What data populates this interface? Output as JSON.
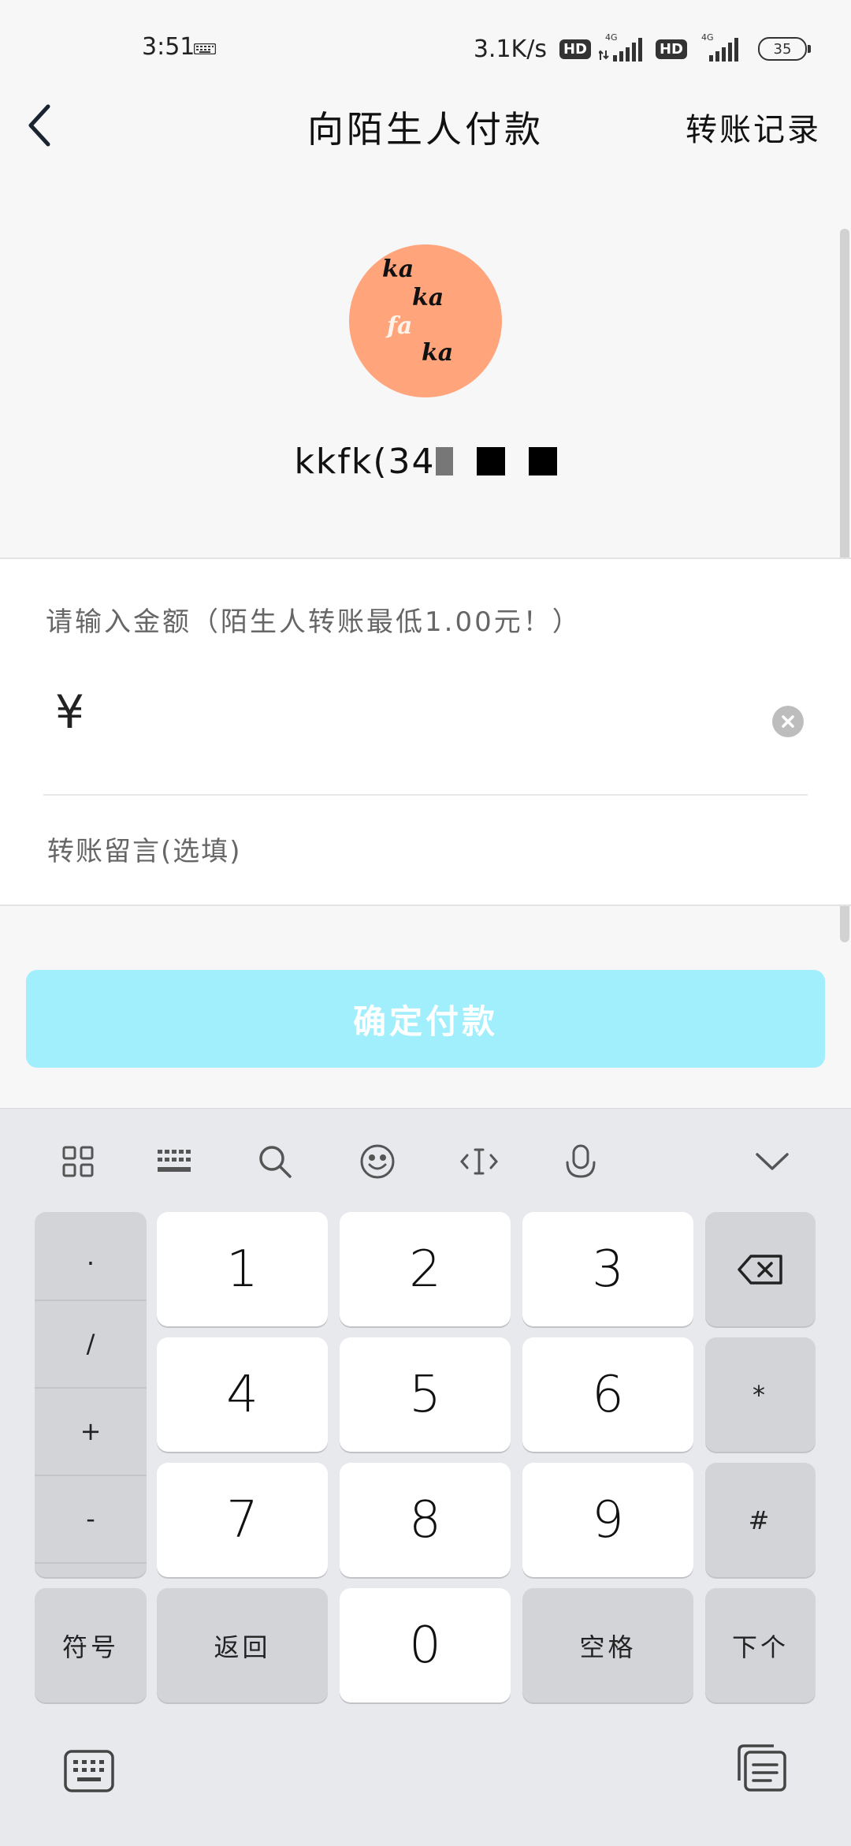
{
  "status_bar": {
    "time": "3:51",
    "net_speed": "3.1K/s",
    "hd_badge": "HD",
    "network_type": "4G",
    "battery": "35"
  },
  "nav": {
    "title": "向陌生人付款",
    "action": "转账记录"
  },
  "profile": {
    "avatar_text": [
      "ka",
      "ka",
      "fa",
      "ka"
    ],
    "name": "kkfk(34"
  },
  "form": {
    "amount_label": "请输入金额（陌生人转账最低1.00元！）",
    "currency_symbol": "¥",
    "amount_value": "",
    "memo_placeholder": "转账留言(选填)"
  },
  "confirm_button": "确定付款",
  "keyboard": {
    "symbols": [
      ".",
      "/",
      "+",
      "-"
    ],
    "digits": [
      "1",
      "2",
      "3",
      "4",
      "5",
      "6",
      "7",
      "8",
      "9",
      "0"
    ],
    "star": "*",
    "hash": "#",
    "symbol_key": "符号",
    "back_key": "返回",
    "space_key": "空格",
    "next_key": "下个"
  },
  "colors": {
    "avatar_bg": "#ffa47b",
    "confirm_bg": "#a1eefc",
    "keyboard_bg": "#e8e9ed"
  }
}
